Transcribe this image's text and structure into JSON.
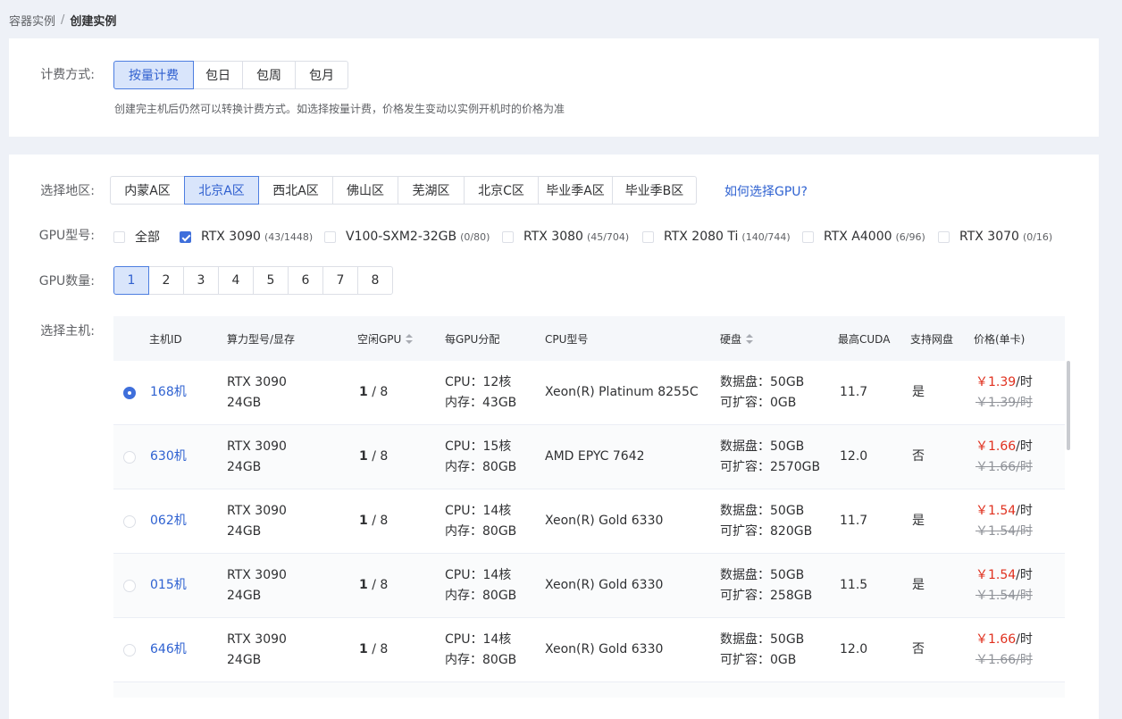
{
  "breadcrumb": {
    "parent": "容器实例",
    "separator": "/",
    "current": "创建实例"
  },
  "billing": {
    "label": "计费方式:",
    "options": [
      "按量计费",
      "包日",
      "包周",
      "包月"
    ],
    "hint": "创建完主机后仍然可以转换计费方式。如选择按量计费，价格发生变动以实例开机时的价格为准"
  },
  "region": {
    "label": "选择地区:",
    "options": [
      "内蒙A区",
      "北京A区",
      "西北A区",
      "佛山区",
      "芜湖区",
      "北京C区",
      "毕业季A区",
      "毕业季B区"
    ],
    "help_link": "如何选择GPU?"
  },
  "gpu_type": {
    "label": "GPU型号:",
    "items": [
      {
        "name": "全部",
        "count": ""
      },
      {
        "name": "RTX 3090",
        "count": "(43/1448)"
      },
      {
        "name": "V100-SXM2-32GB",
        "count": "(0/80)"
      },
      {
        "name": "RTX 3080",
        "count": "(45/704)"
      },
      {
        "name": "RTX 2080 Ti",
        "count": "(140/744)"
      },
      {
        "name": "RTX A4000",
        "count": "(6/96)"
      },
      {
        "name": "RTX 3070",
        "count": "(0/16)"
      }
    ]
  },
  "gpu_count": {
    "label": "GPU数量:",
    "options": [
      "1",
      "2",
      "3",
      "4",
      "5",
      "6",
      "7",
      "8"
    ]
  },
  "host": {
    "label": "选择主机:",
    "columns": [
      "主机ID",
      "算力型号/显存",
      "空闲GPU",
      "每GPU分配",
      "CPU型号",
      "硬盘",
      "最高CUDA",
      "支持网盘",
      "价格(单卡)"
    ],
    "rows": [
      {
        "id": "168机",
        "model": "RTX 3090",
        "vram": "24GB",
        "free": "1",
        "total": " / 8",
        "cpu_alloc": "CPU：12核",
        "mem_alloc": "内存：43GB",
        "cpu": "Xeon(R) Platinum 8255C",
        "disk": "数据盘：50GB",
        "disk_ext": "可扩容：0GB",
        "cuda": "11.7",
        "netdisk": "是",
        "price": "￥1.39",
        "unit": "/时",
        "orig": "￥1.39/时"
      },
      {
        "id": "630机",
        "model": "RTX 3090",
        "vram": "24GB",
        "free": "1",
        "total": " / 8",
        "cpu_alloc": "CPU：15核",
        "mem_alloc": "内存：80GB",
        "cpu": "AMD EPYC 7642",
        "disk": "数据盘：50GB",
        "disk_ext": "可扩容：2570GB",
        "cuda": "12.0",
        "netdisk": "否",
        "price": "￥1.66",
        "unit": "/时",
        "orig": "￥1.66/时"
      },
      {
        "id": "062机",
        "model": "RTX 3090",
        "vram": "24GB",
        "free": "1",
        "total": " / 8",
        "cpu_alloc": "CPU：14核",
        "mem_alloc": "内存：80GB",
        "cpu": "Xeon(R) Gold 6330",
        "disk": "数据盘：50GB",
        "disk_ext": "可扩容：820GB",
        "cuda": "11.7",
        "netdisk": "是",
        "price": "￥1.54",
        "unit": "/时",
        "orig": "￥1.54/时"
      },
      {
        "id": "015机",
        "model": "RTX 3090",
        "vram": "24GB",
        "free": "1",
        "total": " / 8",
        "cpu_alloc": "CPU：14核",
        "mem_alloc": "内存：80GB",
        "cpu": "Xeon(R) Gold 6330",
        "disk": "数据盘：50GB",
        "disk_ext": "可扩容：258GB",
        "cuda": "11.5",
        "netdisk": "是",
        "price": "￥1.54",
        "unit": "/时",
        "orig": "￥1.54/时"
      },
      {
        "id": "646机",
        "model": "RTX 3090",
        "vram": "24GB",
        "free": "1",
        "total": " / 8",
        "cpu_alloc": "CPU：14核",
        "mem_alloc": "内存：80GB",
        "cpu": "Xeon(R) Gold 6330",
        "disk": "数据盘：50GB",
        "disk_ext": "可扩容：0GB",
        "cuda": "12.0",
        "netdisk": "否",
        "price": "￥1.66",
        "unit": "/时",
        "orig": "￥1.66/时"
      }
    ]
  },
  "colors": {
    "accent": "#3f6fdb",
    "price": "#e0301e",
    "active_bg": "#d9e5fb"
  }
}
